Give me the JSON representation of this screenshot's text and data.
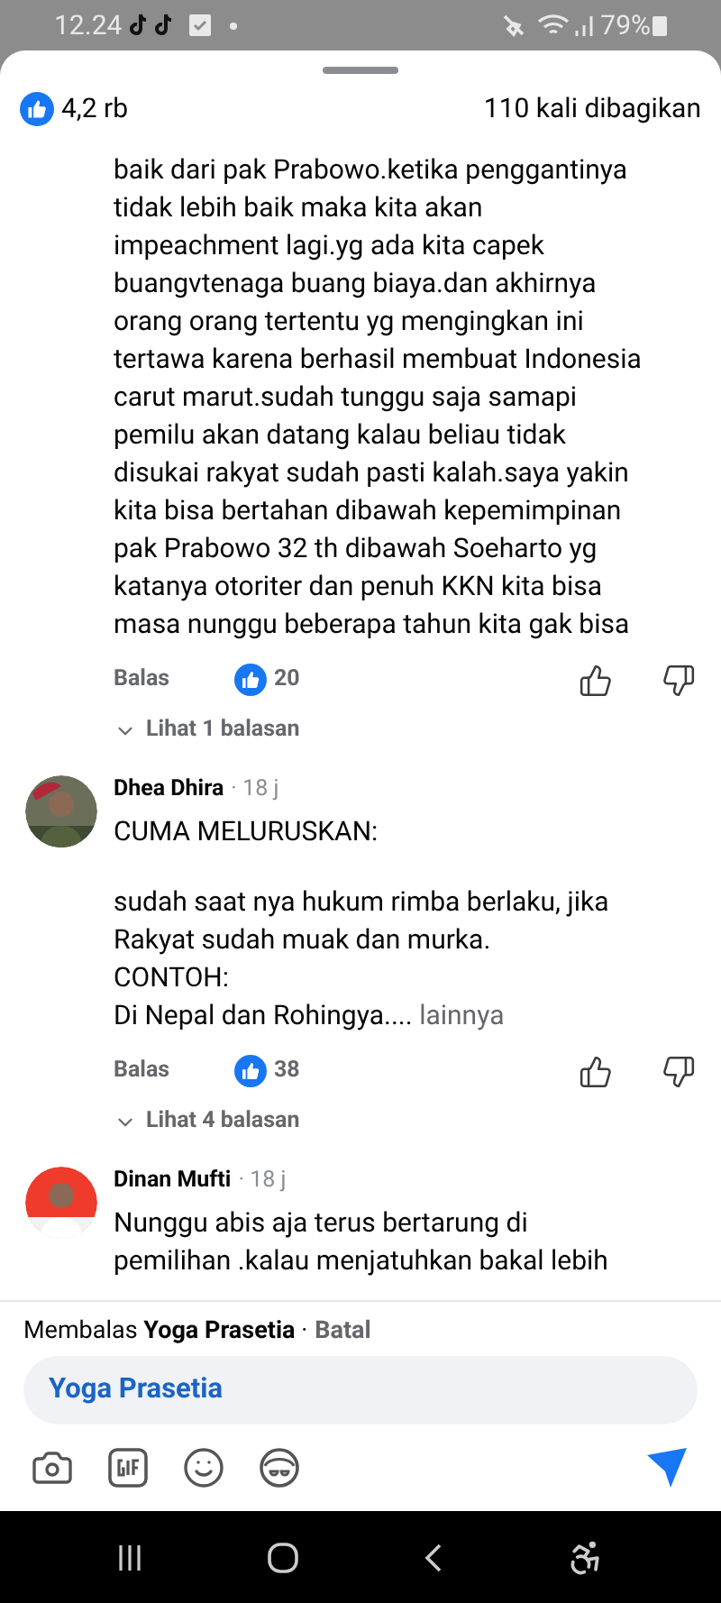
{
  "status_bar": {
    "time": "12.24",
    "battery": "79%"
  },
  "header": {
    "reactions": "4,2 rb",
    "shares": "110 kali dibagikan"
  },
  "comments": [
    {
      "kind": "continuation",
      "paragraphs": [
        [
          "baik dari pak Prabowo.ketika penggantinya",
          "tidak lebih baik maka kita akan",
          "impeachment lagi.yg ada kita capek",
          "buangvtenaga buang biaya.dan akhirnya",
          "orang orang tertentu yg mengingkan ini",
          "tertawa karena berhasil membuat Indonesia",
          "carut marut.sudah tunggu saja samapi",
          "pemilu akan datang kalau beliau tidak",
          "disukai rakyat sudah pasti kalah.saya yakin",
          "kita bisa bertahan dibawah kepemimpinan",
          "pak Prabowo 32 th dibawah Soeharto yg",
          "katanya otoriter dan penuh KKN kita bisa",
          "masa nunggu beberapa tahun kita gak bisa"
        ]
      ],
      "reply": "Balas",
      "likes": "20",
      "view_replies": "Lihat 1 balasan"
    },
    {
      "kind": "full",
      "author": "Dhea Dhira",
      "time": "· 18 j",
      "paragraphs": [
        [
          "CUMA MELURUSKAN:"
        ],
        [
          "sudah saat nya hukum rimba berlaku, jika",
          "Rakyat sudah muak dan murka.",
          "CONTOH:",
          "Di Nepal dan Rohingya...."
        ]
      ],
      "more": "lainnya",
      "reply": "Balas",
      "likes": "38",
      "view_replies": "Lihat 4 balasan"
    },
    {
      "kind": "full",
      "author": "Dinan Mufti",
      "time": "· 18 j",
      "paragraphs": [
        [
          "Nunggu abis aja terus bertarung di",
          "pemilihan .kalau menjatuhkan bakal lebih"
        ]
      ]
    }
  ],
  "composer": {
    "replying_to": "Membalas **Yoga Prasetia** ·",
    "cancel": "Batal",
    "value": "Yoga Prasetia"
  }
}
